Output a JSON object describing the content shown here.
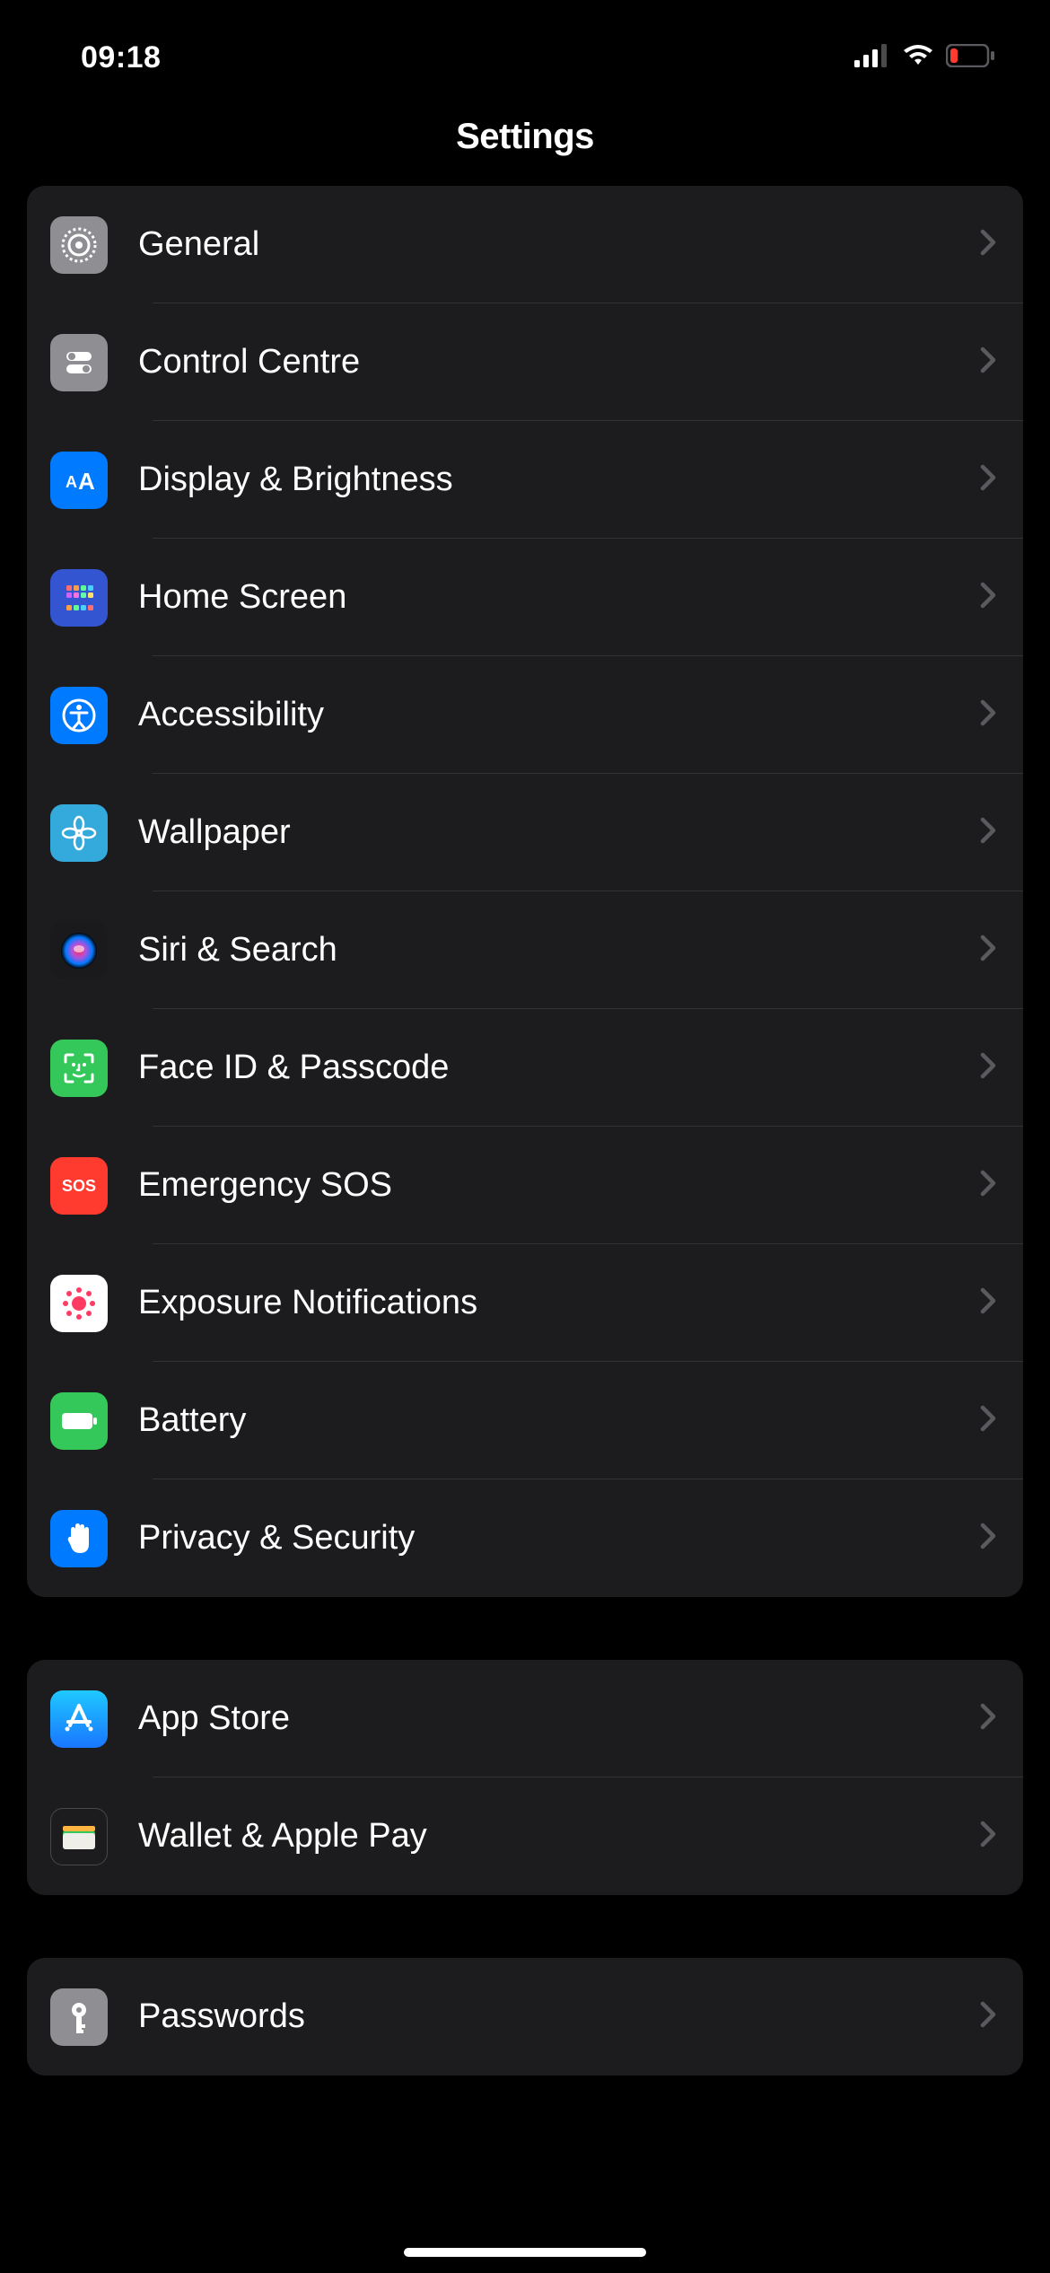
{
  "status": {
    "time": "09:18"
  },
  "header": {
    "title": "Settings"
  },
  "groups": [
    {
      "items": [
        {
          "label": "General",
          "icon": "general"
        },
        {
          "label": "Control Centre",
          "icon": "control-centre"
        },
        {
          "label": "Display & Brightness",
          "icon": "display"
        },
        {
          "label": "Home Screen",
          "icon": "home-screen"
        },
        {
          "label": "Accessibility",
          "icon": "accessibility"
        },
        {
          "label": "Wallpaper",
          "icon": "wallpaper"
        },
        {
          "label": "Siri & Search",
          "icon": "siri"
        },
        {
          "label": "Face ID & Passcode",
          "icon": "faceid"
        },
        {
          "label": "Emergency SOS",
          "icon": "sos"
        },
        {
          "label": "Exposure Notifications",
          "icon": "exposure"
        },
        {
          "label": "Battery",
          "icon": "battery"
        },
        {
          "label": "Privacy & Security",
          "icon": "privacy"
        }
      ]
    },
    {
      "items": [
        {
          "label": "App Store",
          "icon": "appstore"
        },
        {
          "label": "Wallet & Apple Pay",
          "icon": "wallet"
        }
      ]
    },
    {
      "items": [
        {
          "label": "Passwords",
          "icon": "passwords"
        }
      ]
    }
  ]
}
